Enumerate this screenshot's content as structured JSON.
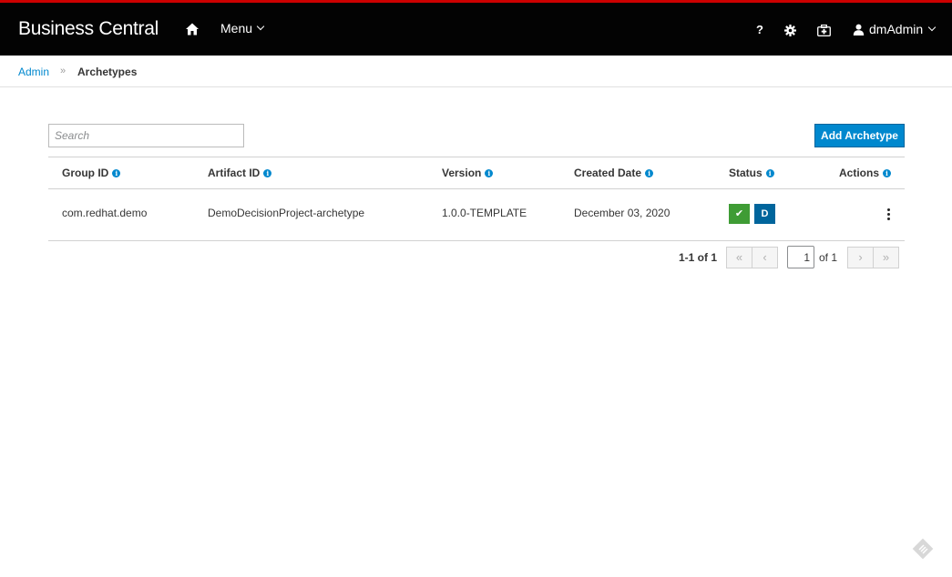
{
  "navbar": {
    "brand": "Business Central",
    "menu_label": "Menu",
    "help_label": "?",
    "user_label": "dmAdmin"
  },
  "breadcrumb": {
    "parent": "Admin",
    "separator": "»",
    "current": "Archetypes"
  },
  "toolbar": {
    "search_placeholder": "Search",
    "add_button": "Add Archetype"
  },
  "table": {
    "columns": [
      "Group ID",
      "Artifact ID",
      "Version",
      "Created Date",
      "Status",
      "Actions"
    ],
    "rows": [
      {
        "group_id": "com.redhat.demo",
        "artifact_id": "DemoDecisionProject-archetype",
        "version": "1.0.0-TEMPLATE",
        "created_date": "December 03, 2020",
        "status_ok": "✔",
        "status_default": "D"
      }
    ]
  },
  "pagination": {
    "count": "1-1 of 1",
    "page": "1",
    "of_pages": "of 1",
    "first": "«",
    "prev": "‹",
    "next": "›",
    "last": "»"
  },
  "colors": {
    "accent": "#0088ce",
    "navbar": "#030303",
    "top_border": "#cc0000",
    "success": "#3f9c35",
    "default_badge": "#00659c"
  }
}
